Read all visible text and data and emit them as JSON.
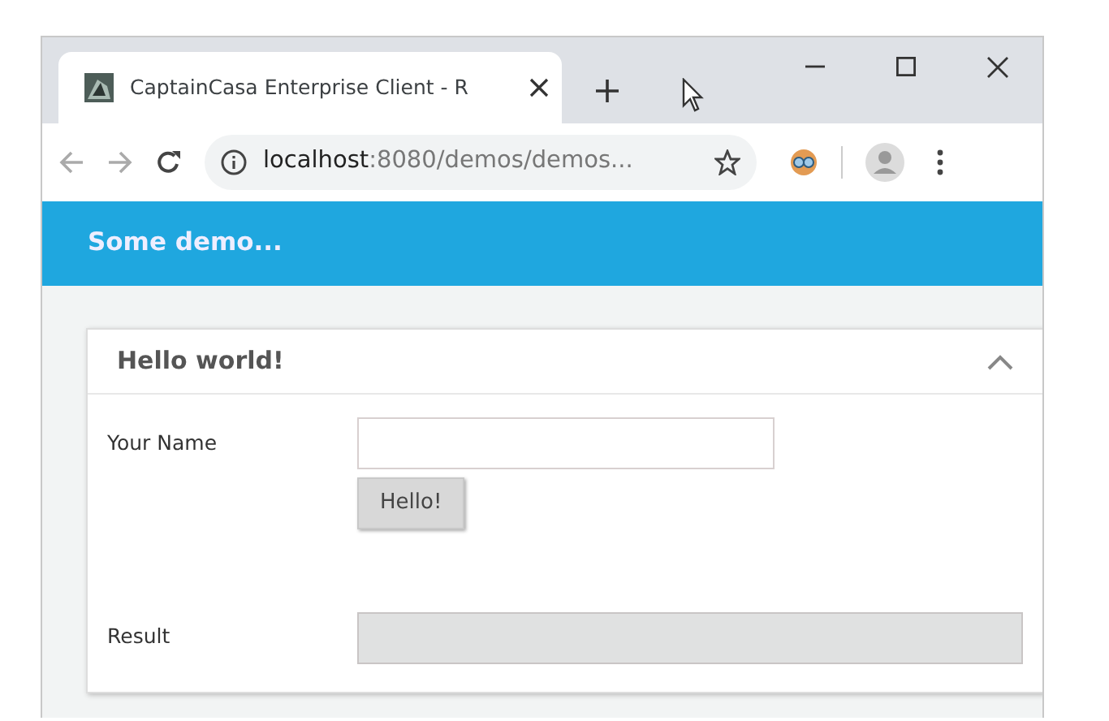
{
  "browser": {
    "tab": {
      "title": "CaptainCasa Enterprise Client - R",
      "selected": true
    },
    "address": {
      "host": "localhost",
      "path": ":8080/demos/demos..."
    }
  },
  "header": {
    "title": "Some demo..."
  },
  "panel": {
    "title": "Hello world!",
    "expanded": true,
    "fields": [
      {
        "kind": "input",
        "label": "Your Name",
        "disabled": false
      },
      {
        "kind": "button",
        "label": "Hello!"
      },
      {
        "kind": "input",
        "label": "Result",
        "disabled": true
      }
    ]
  }
}
